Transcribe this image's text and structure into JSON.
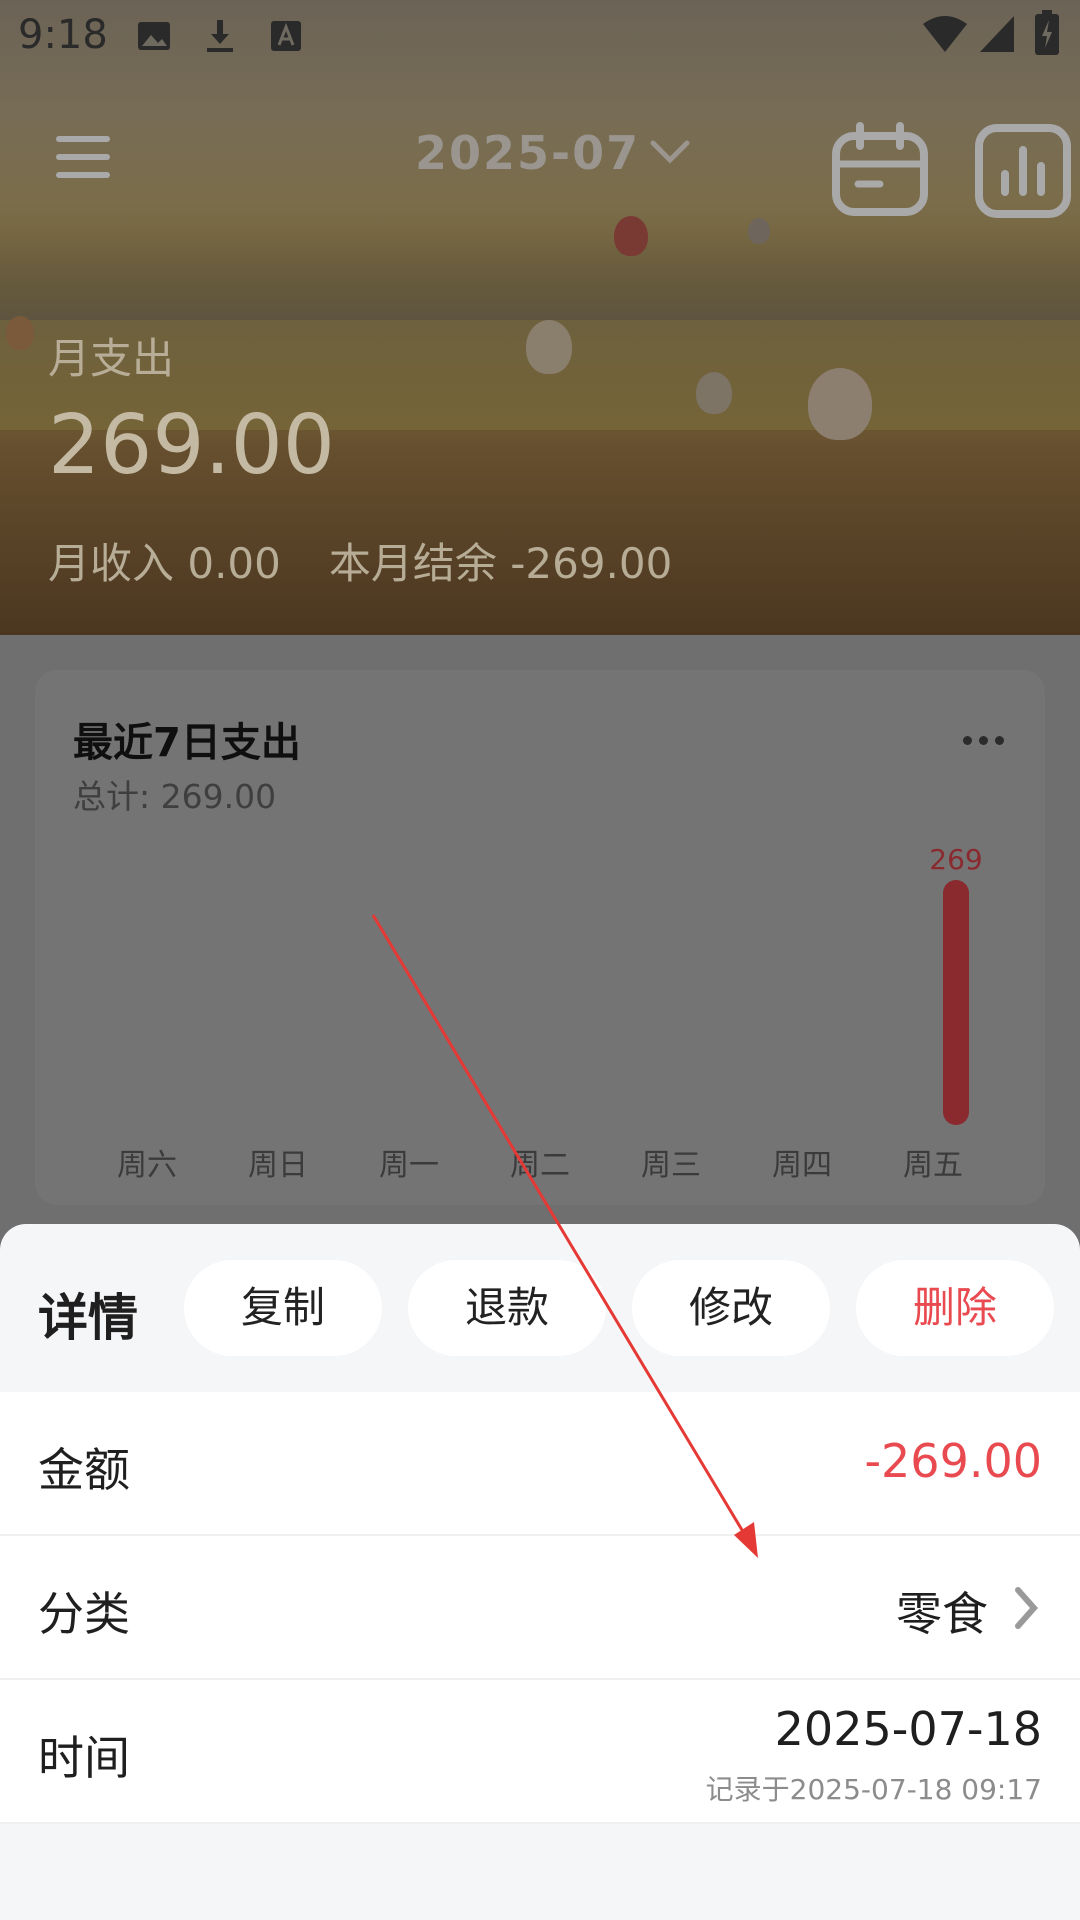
{
  "status_bar": {
    "time": "9:18",
    "icons": [
      "image-icon",
      "download-icon",
      "font-icon",
      "wifi-icon",
      "signal-icon",
      "battery-icon"
    ]
  },
  "header": {
    "month": "2025-07",
    "menu_icon": "hamburger-icon",
    "calendar_icon": "calendar-icon",
    "stats_icon": "bar-chart-icon"
  },
  "summary": {
    "expense_label": "月支出",
    "expense_amount": "269.00",
    "income_text": "月收入 0.00",
    "balance_text": "本月结余 -269.00"
  },
  "recent_card": {
    "title": "最近7日支出",
    "total": "总计: 269.00",
    "more_icon": "more-horizontal-icon"
  },
  "chart_data": {
    "type": "bar",
    "categories": [
      "周六",
      "周日",
      "周一",
      "周二",
      "周三",
      "周四",
      "周五"
    ],
    "values": [
      0,
      0,
      0,
      0,
      0,
      0,
      269
    ],
    "data_labels": [
      "",
      "",
      "",
      "",
      "",
      "",
      "269"
    ],
    "bar_color": "#8a2a2e"
  },
  "detail_sheet": {
    "title": "详情",
    "actions": {
      "copy": "复制",
      "refund": "退款",
      "edit": "修改",
      "delete": "删除"
    },
    "amount_label": "金额",
    "amount_value": "-269.00",
    "category_label": "分类",
    "category_value": "零食",
    "time_label": "时间",
    "time_value": "2025-07-18",
    "recorded_at": "记录于2025-07-18 09:17"
  },
  "colors": {
    "accent_red": "#e84a50",
    "sheet_bg": "#f5f6f8",
    "overlay": "#6f6f70",
    "annotation_arrow": "#e53935"
  }
}
